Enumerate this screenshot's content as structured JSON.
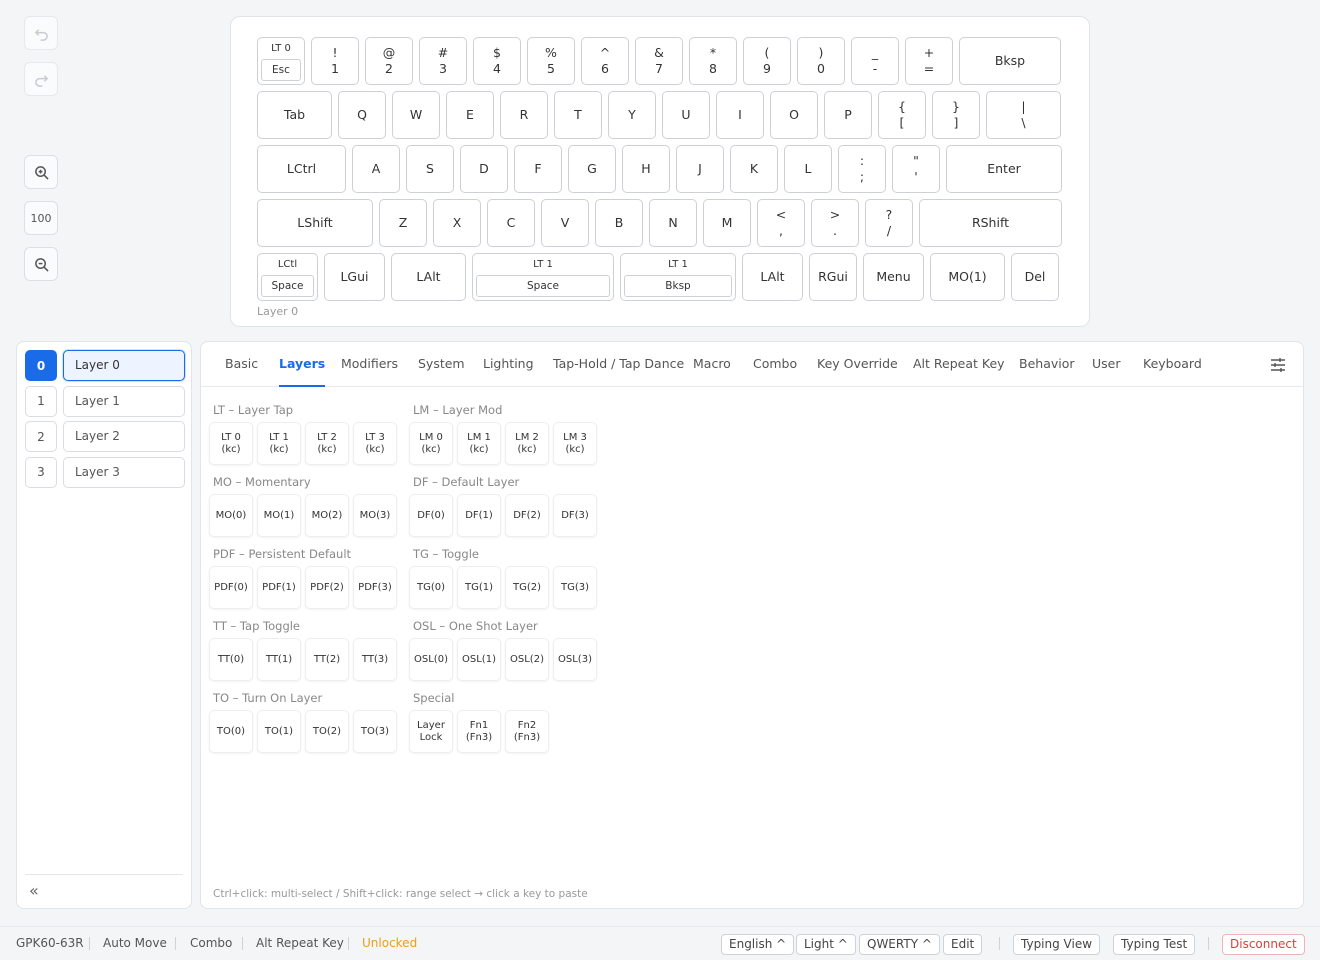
{
  "toolbar": {
    "undo_icon": "undo-icon",
    "redo_icon": "redo-icon",
    "zoom_in_icon": "zoom-in-icon",
    "zoom_level": "100",
    "zoom_out_icon": "zoom-out-icon"
  },
  "keyboard": {
    "caption": "Layer 0",
    "rows": [
      [
        {
          "d": [
            "LT 0",
            "Esc"
          ]
        },
        {
          "l": [
            "!",
            "1"
          ]
        },
        {
          "l": [
            "@",
            "2"
          ]
        },
        {
          "l": [
            "#",
            "3"
          ]
        },
        {
          "l": [
            "$",
            "4"
          ]
        },
        {
          "l": [
            "%",
            "5"
          ]
        },
        {
          "l": [
            "^",
            "6"
          ]
        },
        {
          "l": [
            "&",
            "7"
          ]
        },
        {
          "l": [
            "*",
            "8"
          ]
        },
        {
          "l": [
            "(",
            "9"
          ]
        },
        {
          "l": [
            ")",
            "0"
          ]
        },
        {
          "l": [
            "_",
            "-"
          ]
        },
        {
          "l": [
            "+",
            "="
          ]
        },
        {
          "l": [
            "Bksp"
          ]
        }
      ],
      [
        {
          "l": [
            "Tab"
          ]
        },
        {
          "l": [
            "Q"
          ]
        },
        {
          "l": [
            "W"
          ]
        },
        {
          "l": [
            "E"
          ]
        },
        {
          "l": [
            "R"
          ]
        },
        {
          "l": [
            "T"
          ]
        },
        {
          "l": [
            "Y"
          ]
        },
        {
          "l": [
            "U"
          ]
        },
        {
          "l": [
            "I"
          ]
        },
        {
          "l": [
            "O"
          ]
        },
        {
          "l": [
            "P"
          ]
        },
        {
          "l": [
            "{",
            "["
          ]
        },
        {
          "l": [
            "}",
            "]"
          ]
        },
        {
          "l": [
            "|",
            "\\"
          ]
        }
      ],
      [
        {
          "l": [
            "LCtrl"
          ]
        },
        {
          "l": [
            "A"
          ]
        },
        {
          "l": [
            "S"
          ]
        },
        {
          "l": [
            "D"
          ]
        },
        {
          "l": [
            "F"
          ]
        },
        {
          "l": [
            "G"
          ]
        },
        {
          "l": [
            "H"
          ]
        },
        {
          "l": [
            "J"
          ]
        },
        {
          "l": [
            "K"
          ]
        },
        {
          "l": [
            "L"
          ]
        },
        {
          "l": [
            ":",
            ";"
          ]
        },
        {
          "l": [
            "\"",
            "'"
          ]
        },
        {
          "l": [
            "Enter"
          ]
        }
      ],
      [
        {
          "l": [
            "LShift"
          ]
        },
        {
          "l": [
            "Z"
          ]
        },
        {
          "l": [
            "X"
          ]
        },
        {
          "l": [
            "C"
          ]
        },
        {
          "l": [
            "V"
          ]
        },
        {
          "l": [
            "B"
          ]
        },
        {
          "l": [
            "N"
          ]
        },
        {
          "l": [
            "M"
          ]
        },
        {
          "l": [
            "<",
            ","
          ]
        },
        {
          "l": [
            ">",
            "."
          ]
        },
        {
          "l": [
            "?",
            "/"
          ]
        },
        {
          "l": [
            "RShift"
          ]
        }
      ],
      [
        {
          "d": [
            "LCtl",
            "Space"
          ]
        },
        {
          "l": [
            "LGui"
          ]
        },
        {
          "l": [
            "LAlt"
          ]
        },
        {
          "d": [
            "LT 1",
            "Space"
          ]
        },
        {
          "d": [
            "LT 1",
            "Bksp"
          ]
        },
        {
          "l": [
            "LAlt"
          ]
        },
        {
          "l": [
            "RGui"
          ]
        },
        {
          "l": [
            "Menu"
          ]
        },
        {
          "l": [
            "MO(1)"
          ]
        },
        {
          "l": [
            "Del"
          ]
        }
      ]
    ]
  },
  "layers": [
    {
      "num": "0",
      "name": "Layer 0"
    },
    {
      "num": "1",
      "name": "Layer 1"
    },
    {
      "num": "2",
      "name": "Layer 2"
    },
    {
      "num": "3",
      "name": "Layer 3"
    }
  ],
  "selected_layer": 0,
  "collapse_label": "«",
  "tabs": [
    "Basic",
    "Layers",
    "Modifiers",
    "System",
    "Lighting",
    "Tap-Hold / Tap Dance",
    "Macro",
    "Combo",
    "Key Override",
    "Alt Repeat Key",
    "Behavior",
    "User",
    "Keyboard"
  ],
  "active_tab": 1,
  "sections": [
    {
      "title": "LT – Layer Tap",
      "keys": [
        "LT 0\n(kc)",
        "LT 1\n(kc)",
        "LT 2\n(kc)",
        "LT 3\n(kc)"
      ]
    },
    {
      "title": "LM – Layer Mod",
      "keys": [
        "LM 0\n(kc)",
        "LM 1\n(kc)",
        "LM 2\n(kc)",
        "LM 3\n(kc)"
      ]
    },
    {
      "title": "MO – Momentary",
      "keys": [
        "MO(0)",
        "MO(1)",
        "MO(2)",
        "MO(3)"
      ]
    },
    {
      "title": "DF – Default Layer",
      "keys": [
        "DF(0)",
        "DF(1)",
        "DF(2)",
        "DF(3)"
      ]
    },
    {
      "title": "PDF – Persistent Default",
      "keys": [
        "PDF(0)",
        "PDF(1)",
        "PDF(2)",
        "PDF(3)"
      ]
    },
    {
      "title": "TG – Toggle",
      "keys": [
        "TG(0)",
        "TG(1)",
        "TG(2)",
        "TG(3)"
      ]
    },
    {
      "title": "TT – Tap Toggle",
      "keys": [
        "TT(0)",
        "TT(1)",
        "TT(2)",
        "TT(3)"
      ]
    },
    {
      "title": "OSL – One Shot Layer",
      "keys": [
        "OSL(0)",
        "OSL(1)",
        "OSL(2)",
        "OSL(3)"
      ]
    },
    {
      "title": "TO – Turn On Layer",
      "keys": [
        "TO(0)",
        "TO(1)",
        "TO(2)",
        "TO(3)"
      ]
    },
    {
      "title": "Special",
      "keys": [
        "Layer\nLock",
        "Fn1\n(Fn3)",
        "Fn2\n(Fn3)"
      ]
    }
  ],
  "hint": "Ctrl+click: multi-select / Shift+click: range select → click a key to paste",
  "status": {
    "device": "GPK60-63R",
    "auto_move": "Auto Move",
    "combo": "Combo",
    "alt_repeat": "Alt Repeat Key",
    "lock_state": "Unlocked",
    "language": "English ^",
    "theme": "Light ^",
    "layout": "QWERTY ^",
    "edit": "Edit",
    "typing_view": "Typing View",
    "typing_test": "Typing Test",
    "disconnect": "Disconnect"
  },
  "colors": {
    "accent": "#1a6be8",
    "unlocked": "#e6a11a",
    "disconnect": "#e03b3b"
  }
}
